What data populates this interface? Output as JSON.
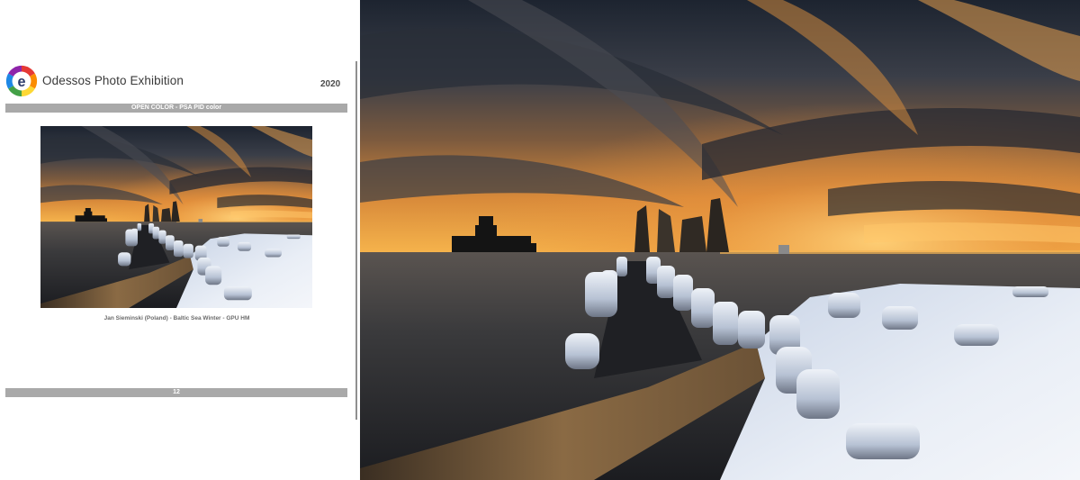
{
  "catalogue": {
    "brand": "Odessos Photo Exhibition",
    "year": "2020",
    "section": "OPEN COLOR - PSA PID color",
    "caption": "Jan Sieminski (Poland) - Baltic Sea Winter - GPU HM",
    "page_number": "12"
  },
  "logo_letter": "e",
  "colors": {
    "bar": "#a9a9a9",
    "brand_text": "#3a3a3a",
    "logo_segments": [
      "#e53935",
      "#fb8c00",
      "#fdd835",
      "#43a047",
      "#1e88e5",
      "#8e24aa"
    ]
  }
}
